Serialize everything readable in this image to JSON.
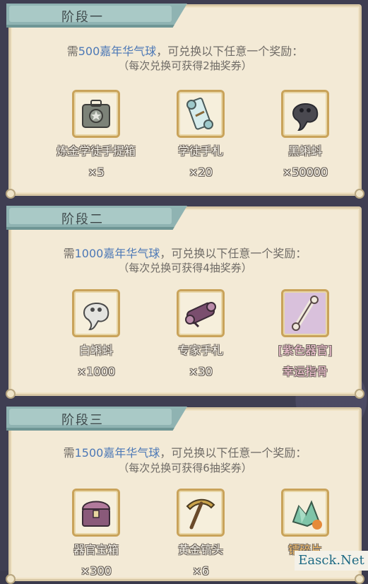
{
  "stages": [
    {
      "title": "阶段一",
      "requirement": {
        "prefix": "需",
        "amount": "500",
        "currency": "嘉年华气球",
        "suffix": "，可兑换以下任意一个奖励："
      },
      "note": "（每次兑换可获得2抽奖券）",
      "rewards": [
        {
          "name": "炼金学徒手提箱",
          "qty": "×5",
          "icon": "alchemy-case-icon"
        },
        {
          "name": "学徒手札",
          "qty": "×20",
          "icon": "scroll-icon"
        },
        {
          "name": "黑蝌蚪",
          "qty": "×50000",
          "icon": "black-tadpole-icon"
        }
      ]
    },
    {
      "title": "阶段二",
      "requirement": {
        "prefix": "需",
        "amount": "1000",
        "currency": "嘉年华气球",
        "suffix": "，可兑换以下任意一个奖励："
      },
      "note": "（每次兑换可获得4抽奖券）",
      "rewards": [
        {
          "name": "白蝌蚪",
          "qty": "×1000",
          "icon": "white-tadpole-icon"
        },
        {
          "name": "专家手札",
          "qty": "×30",
          "icon": "expert-scroll-icon"
        },
        {
          "name": "[紫色器官]",
          "qty": "幸运指骨",
          "icon": "finger-bone-icon"
        }
      ]
    },
    {
      "title": "阶段三",
      "requirement": {
        "prefix": "需",
        "amount": "1500",
        "currency": "嘉年华气球",
        "suffix": "，可兑换以下任意一个奖励："
      },
      "note": "（每次兑换可获得6抽奖券）",
      "rewards": [
        {
          "name": "器官宝箱",
          "qty": "×300",
          "icon": "treasure-chest-icon"
        },
        {
          "name": "黄金镐头",
          "qty": "×6",
          "icon": "golden-pickaxe-icon"
        },
        {
          "name": "镭碎片",
          "qty": "",
          "icon": "radium-shard-icon"
        }
      ]
    }
  ],
  "watermark": "Easck.Net",
  "colors": {
    "panel": "#f3ead6",
    "banner": "#8fb3b2",
    "highlight": "#4c78b6",
    "frame": "#c9a35a"
  }
}
